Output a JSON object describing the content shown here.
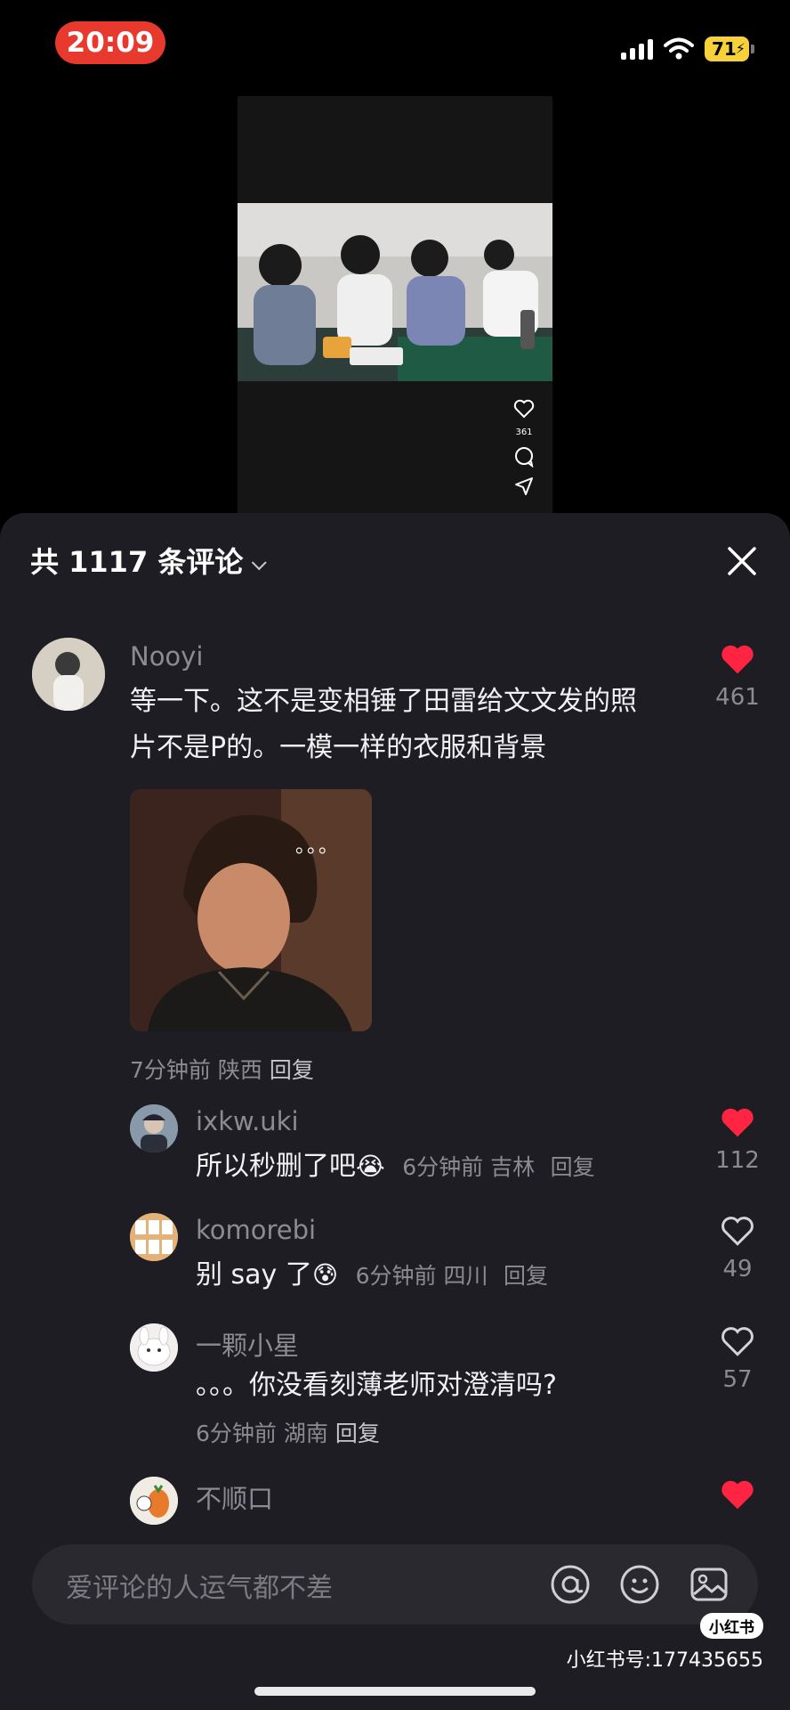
{
  "status": {
    "time": "20:09",
    "battery": "71"
  },
  "video": {
    "like_count": "361"
  },
  "sheet": {
    "header": "共 1117 条评论"
  },
  "comments": [
    {
      "user": "Nooyi",
      "text_line1": "等一下。这不是变相锤了田雷给文文发的照",
      "text_line2": "片不是P的。一模一样的衣服和背景",
      "meta": "7分钟前 陕西",
      "reply": "回复",
      "likes": "461",
      "liked": true
    },
    {
      "user": "ixkw.uki",
      "text": "所以秒删了吧",
      "meta": "6分钟前 吉林",
      "reply": "回复",
      "likes": "112",
      "liked": true
    },
    {
      "user": "komorebi",
      "text": "别 say 了",
      "meta": "6分钟前 四川",
      "reply": "回复",
      "likes": "49",
      "liked": false
    },
    {
      "user": "一颗小星",
      "text": "。。。你没看刻薄老师对澄清吗?",
      "meta": "6分钟前 湖南",
      "reply": "回复",
      "likes": "57",
      "liked": false
    },
    {
      "user": "不顺口",
      "liked": true
    }
  ],
  "comment_image": {
    "overlay": "。。。"
  },
  "input": {
    "placeholder": "爱评论的人运气都不差"
  },
  "watermark": {
    "logo": "小红书",
    "text": "小红书号:177435655"
  },
  "colors": {
    "liked": "#ff2442",
    "sheet_bg": "#1e1d23",
    "time_pill": "#e8392f"
  },
  "icons": [
    "heart-icon",
    "comment-icon",
    "share-icon",
    "close-icon",
    "at-icon",
    "emoji-icon",
    "image-icon",
    "signal-icon",
    "wifi-icon",
    "battery-icon"
  ]
}
